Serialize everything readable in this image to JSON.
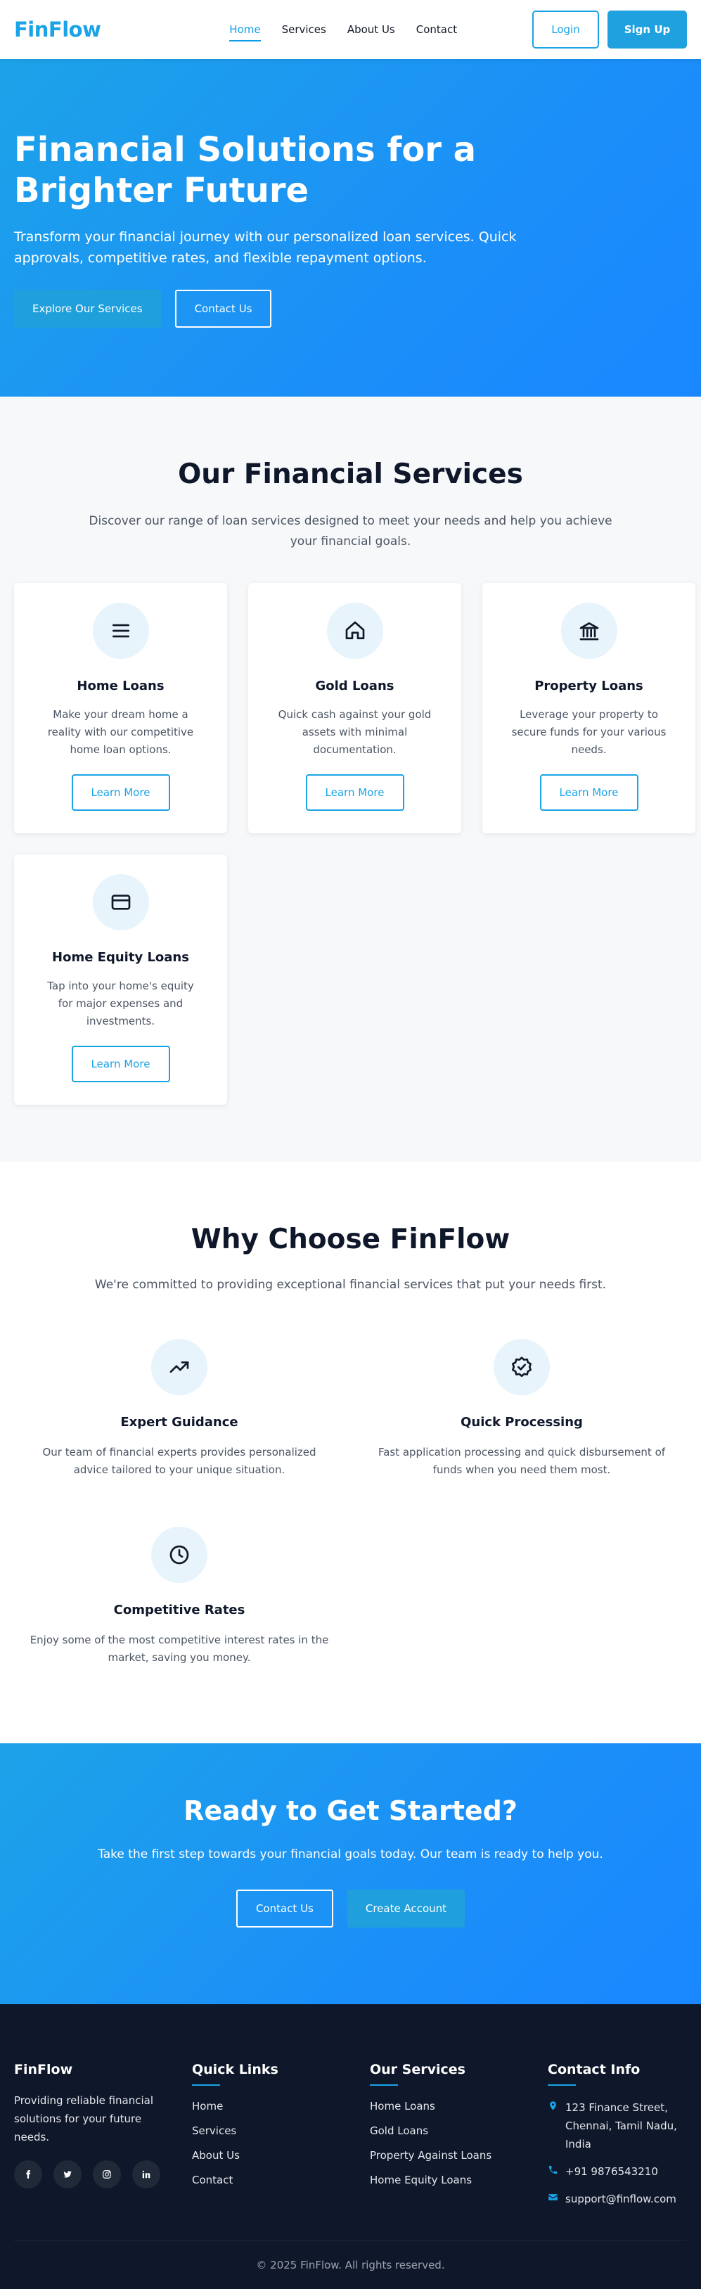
{
  "nav": {
    "logo": "FinFlow",
    "links": [
      "Home",
      "Services",
      "About Us",
      "Contact"
    ],
    "login": "Login",
    "signup": "Sign Up"
  },
  "hero": {
    "title": "Financial Solutions for a Brighter Future",
    "subtitle": "Transform your financial journey with our personalized loan services. Quick approvals, competitive rates, and flexible repayment options.",
    "primary_btn": "Explore Our Services",
    "secondary_btn": "Contact Us"
  },
  "services": {
    "title": "Our Financial Services",
    "subtitle": "Discover our range of loan services designed to meet your needs and help you achieve your financial goals.",
    "cards": [
      {
        "title": "Home Loans",
        "desc": "Make your dream home a reality with our competitive home loan options.",
        "button": "Learn More",
        "icon": "menu-icon"
      },
      {
        "title": "Gold Loans",
        "desc": "Quick cash against your gold assets with minimal documentation.",
        "button": "Learn More",
        "icon": "home-icon"
      },
      {
        "title": "Property Loans",
        "desc": "Leverage your property to secure funds for your various needs.",
        "button": "Learn More",
        "icon": "bank-icon"
      },
      {
        "title": "Home Equity Loans",
        "desc": "Tap into your home's equity for major expenses and investments.",
        "button": "Learn More",
        "icon": "credit-card-icon"
      }
    ]
  },
  "why": {
    "title": "Why Choose FinFlow",
    "subtitle": "We're committed to providing exceptional financial services that put your needs first.",
    "features": [
      {
        "title": "Expert Guidance",
        "desc": "Our team of financial experts provides personalized advice tailored to your unique situation.",
        "icon": "trending-up-icon"
      },
      {
        "title": "Quick Processing",
        "desc": "Fast application processing and quick disbursement of funds when you need them most.",
        "icon": "badge-check-icon"
      },
      {
        "title": "Competitive Rates",
        "desc": "Enjoy some of the most competitive interest rates in the market, saving you money.",
        "icon": "clock-icon"
      }
    ]
  },
  "cta": {
    "title": "Ready to Get Started?",
    "subtitle": "Take the first step towards your financial goals today. Our team is ready to help you.",
    "contact_btn": "Contact Us",
    "create_btn": "Create Account"
  },
  "footer": {
    "brand": "FinFlow",
    "desc": "Providing reliable financial solutions for your future needs.",
    "socials": [
      "facebook-icon",
      "twitter-icon",
      "instagram-icon",
      "linkedin-icon"
    ],
    "quick_links_title": "Quick Links",
    "quick_links": [
      "Home",
      "Services",
      "About Us",
      "Contact"
    ],
    "services_title": "Our Services",
    "services": [
      "Home Loans",
      "Gold Loans",
      "Property Against Loans",
      "Home Equity Loans"
    ],
    "contact_title": "Contact Info",
    "address": "123 Finance Street, Chennai, Tamil Nadu, India",
    "phone": "+91 9876543210",
    "email": "support@finflow.com",
    "copyright": "© 2025 FinFlow. All rights reserved."
  },
  "colors": {
    "accent": "#1aa3e6",
    "hero_gradient_start": "#1da3e8",
    "hero_gradient_end": "#1a87ff",
    "footer_bg": "#0f172a"
  }
}
